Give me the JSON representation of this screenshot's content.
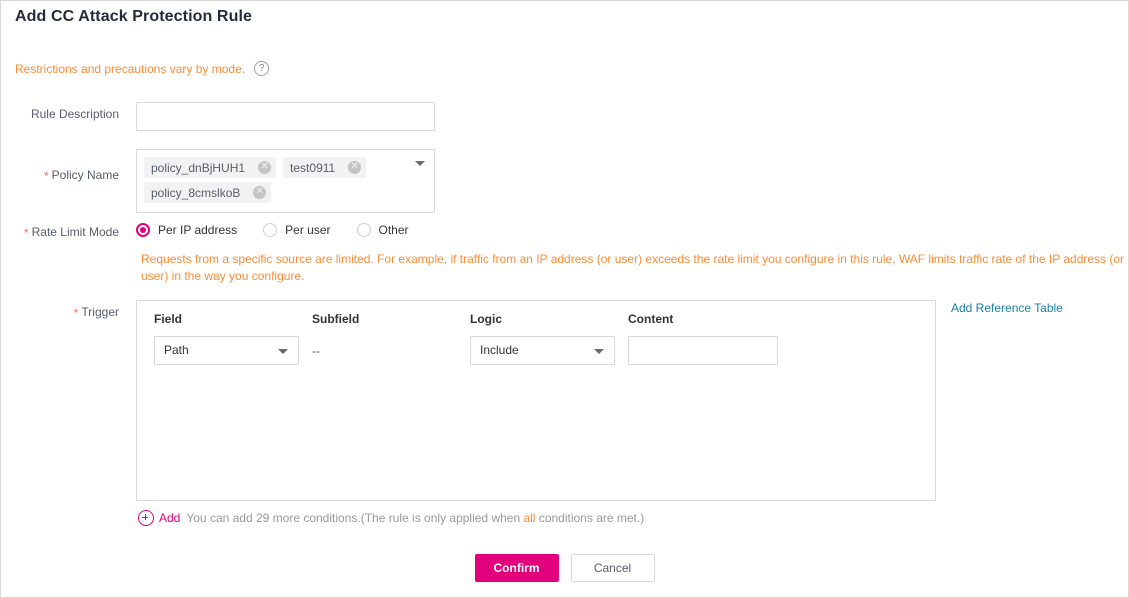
{
  "dialog": {
    "title": "Add CC Attack Protection Rule"
  },
  "notice": {
    "text": "Restrictions and precautions vary by mode.",
    "help_icon": "question-circle-icon",
    "color": "#fa8c36"
  },
  "form": {
    "rule_description": {
      "label": "Rule Description",
      "value": "",
      "placeholder": ""
    },
    "policy_name": {
      "label": "Policy Name",
      "required_marker": "*",
      "tags": [
        {
          "text": "policy_dnBjHUH1",
          "remove_icon": "close-circle-icon"
        },
        {
          "text": "test0911",
          "remove_icon": "close-circle-icon"
        },
        {
          "text": "policy_8cmslkoB",
          "remove_icon": "close-circle-icon"
        }
      ],
      "caret_icon": "chevron-down-icon"
    },
    "rate_limit_mode": {
      "label": "Rate Limit Mode",
      "required_marker": "*",
      "options": [
        {
          "label": "Per IP address",
          "selected": true
        },
        {
          "label": "Per user",
          "selected": false
        },
        {
          "label": "Other",
          "selected": false
        }
      ],
      "help_text": "Requests from a specific source are limited. For example, if traffic from an IP address (or user) exceeds the rate limit you configure in this rule, WAF limits traffic rate of the IP address (or user) in the way you configure."
    },
    "trigger": {
      "label": "Trigger",
      "required_marker": "*",
      "columns": [
        "Field",
        "Subfield",
        "Logic",
        "Content"
      ],
      "rows": [
        {
          "field": "Path",
          "field_caret_icon": "chevron-down-icon",
          "subfield": "--",
          "logic": "Include",
          "logic_caret_icon": "chevron-down-icon",
          "content": "",
          "content_placeholder": ""
        }
      ],
      "reference_link": "Add Reference Table"
    }
  },
  "add_condition": {
    "plus_icon": "plus-circle-icon",
    "add_label": "Add",
    "hint_before": "You can add 29 more conditions.(The rule is only applied when ",
    "hint_highlight": "all",
    "hint_after": " conditions are met.)",
    "remaining_count": 29
  },
  "footer": {
    "confirm_label": "Confirm",
    "cancel_label": "Cancel"
  },
  "theme": {
    "accent": "#e3007c",
    "warning": "#fa8c36",
    "link": "#1b7fa8",
    "required": "#f66f6a",
    "border": "#d9d9d9"
  }
}
